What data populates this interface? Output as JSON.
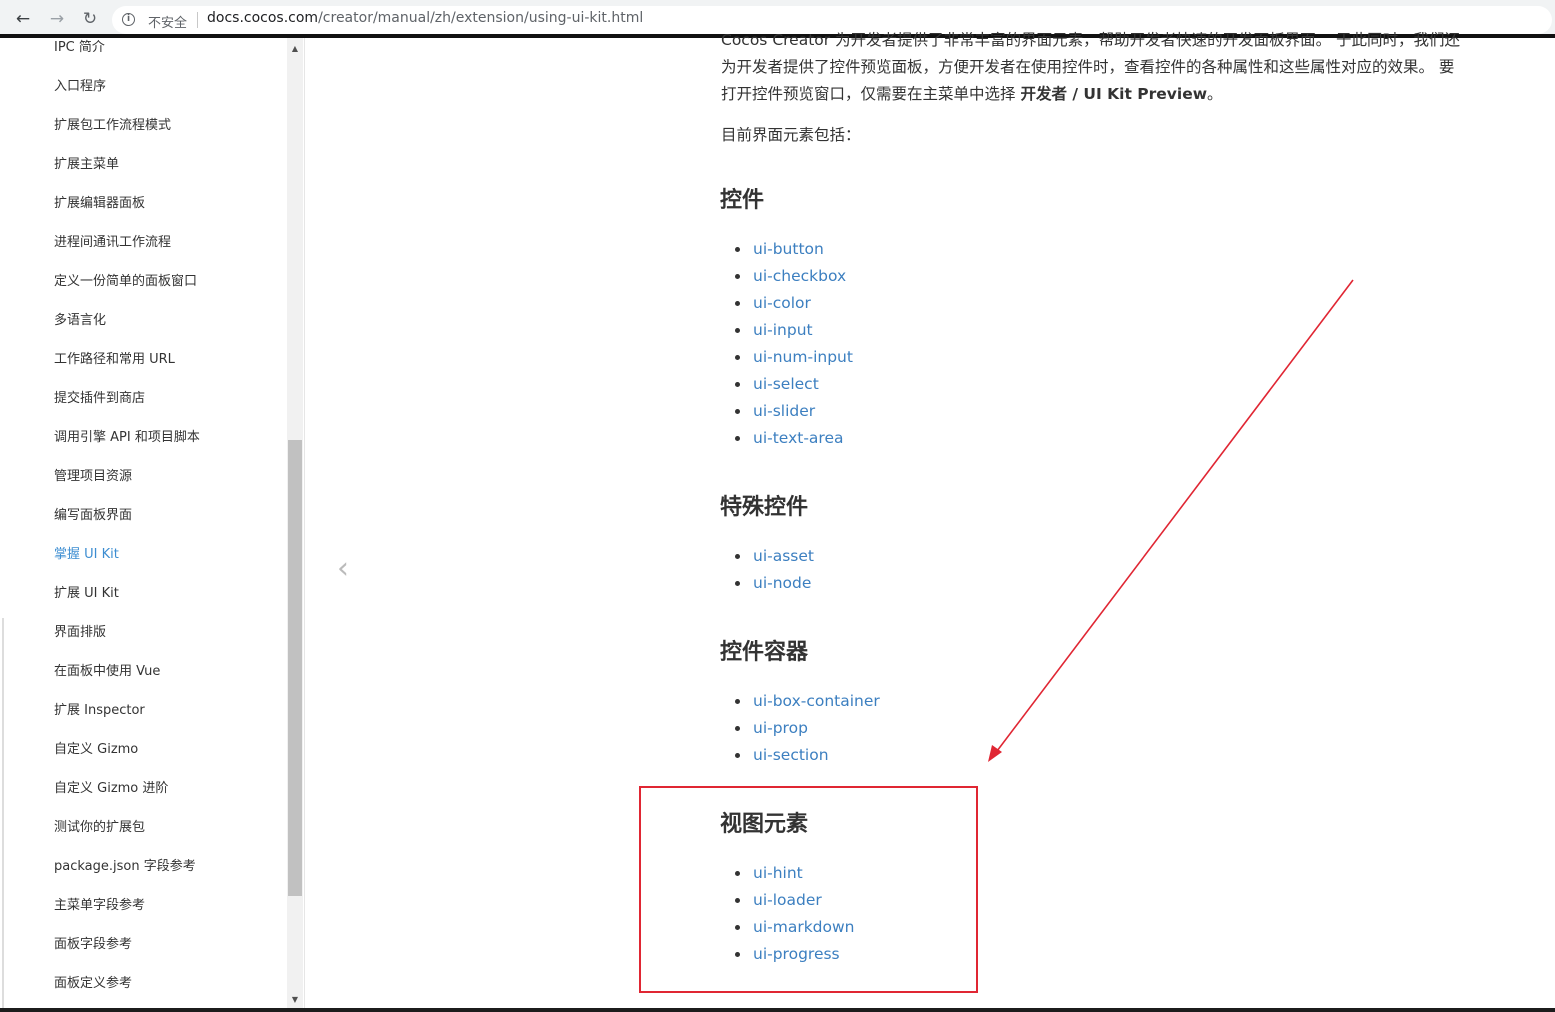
{
  "browser": {
    "security_label": "不安全",
    "url_host": "docs.cocos.com",
    "url_path": "/creator/manual/zh/extension/using-ui-kit.html"
  },
  "sidebar": {
    "items": [
      {
        "label": "IPC 简介"
      },
      {
        "label": "入口程序"
      },
      {
        "label": "扩展包工作流程模式"
      },
      {
        "label": "扩展主菜单"
      },
      {
        "label": "扩展编辑器面板"
      },
      {
        "label": "进程间通讯工作流程"
      },
      {
        "label": "定义一份简单的面板窗口"
      },
      {
        "label": "多语言化"
      },
      {
        "label": "工作路径和常用 URL"
      },
      {
        "label": "提交插件到商店"
      },
      {
        "label": "调用引擎 API 和项目脚本"
      },
      {
        "label": "管理项目资源"
      },
      {
        "label": "编写面板界面"
      },
      {
        "label": "掌握 UI Kit",
        "active": true
      },
      {
        "label": "扩展 UI Kit"
      },
      {
        "label": "界面排版"
      },
      {
        "label": "在面板中使用 Vue"
      },
      {
        "label": "扩展 Inspector"
      },
      {
        "label": "自定义 Gizmo"
      },
      {
        "label": "自定义 Gizmo 进阶"
      },
      {
        "label": "测试你的扩展包"
      },
      {
        "label": "package.json 字段参考"
      },
      {
        "label": "主菜单字段参考"
      },
      {
        "label": "面板字段参考"
      },
      {
        "label": "面板定义参考"
      }
    ]
  },
  "content": {
    "intro_top": "Cocos Creator 为开发者提供了非常丰富的界面元素，帮助开发者快速的开发面板界面。 于此同时，我们还",
    "intro_line2": "为开发者提供了控件预览面板，方便开发者在使用控件时，查看控件的各种属性和这些属性对应的效果。 要",
    "intro_line3_prefix": "打开控件预览窗口，仅需要在主菜单中选择 ",
    "intro_line3_bold": "开发者 / UI Kit Preview",
    "intro_line3_suffix": "。",
    "elements_intro": "目前界面元素包括：",
    "sections": [
      {
        "heading": "控件",
        "items": [
          "ui-button",
          "ui-checkbox",
          "ui-color",
          "ui-input",
          "ui-num-input",
          "ui-select",
          "ui-slider",
          "ui-text-area"
        ]
      },
      {
        "heading": "特殊控件",
        "items": [
          "ui-asset",
          "ui-node"
        ]
      },
      {
        "heading": "控件容器",
        "items": [
          "ui-box-container",
          "ui-prop",
          "ui-section"
        ]
      },
      {
        "heading": "视图元素",
        "items": [
          "ui-hint",
          "ui-loader",
          "ui-markdown",
          "ui-progress"
        ]
      }
    ]
  },
  "annotation": {
    "color": "#e02633"
  }
}
